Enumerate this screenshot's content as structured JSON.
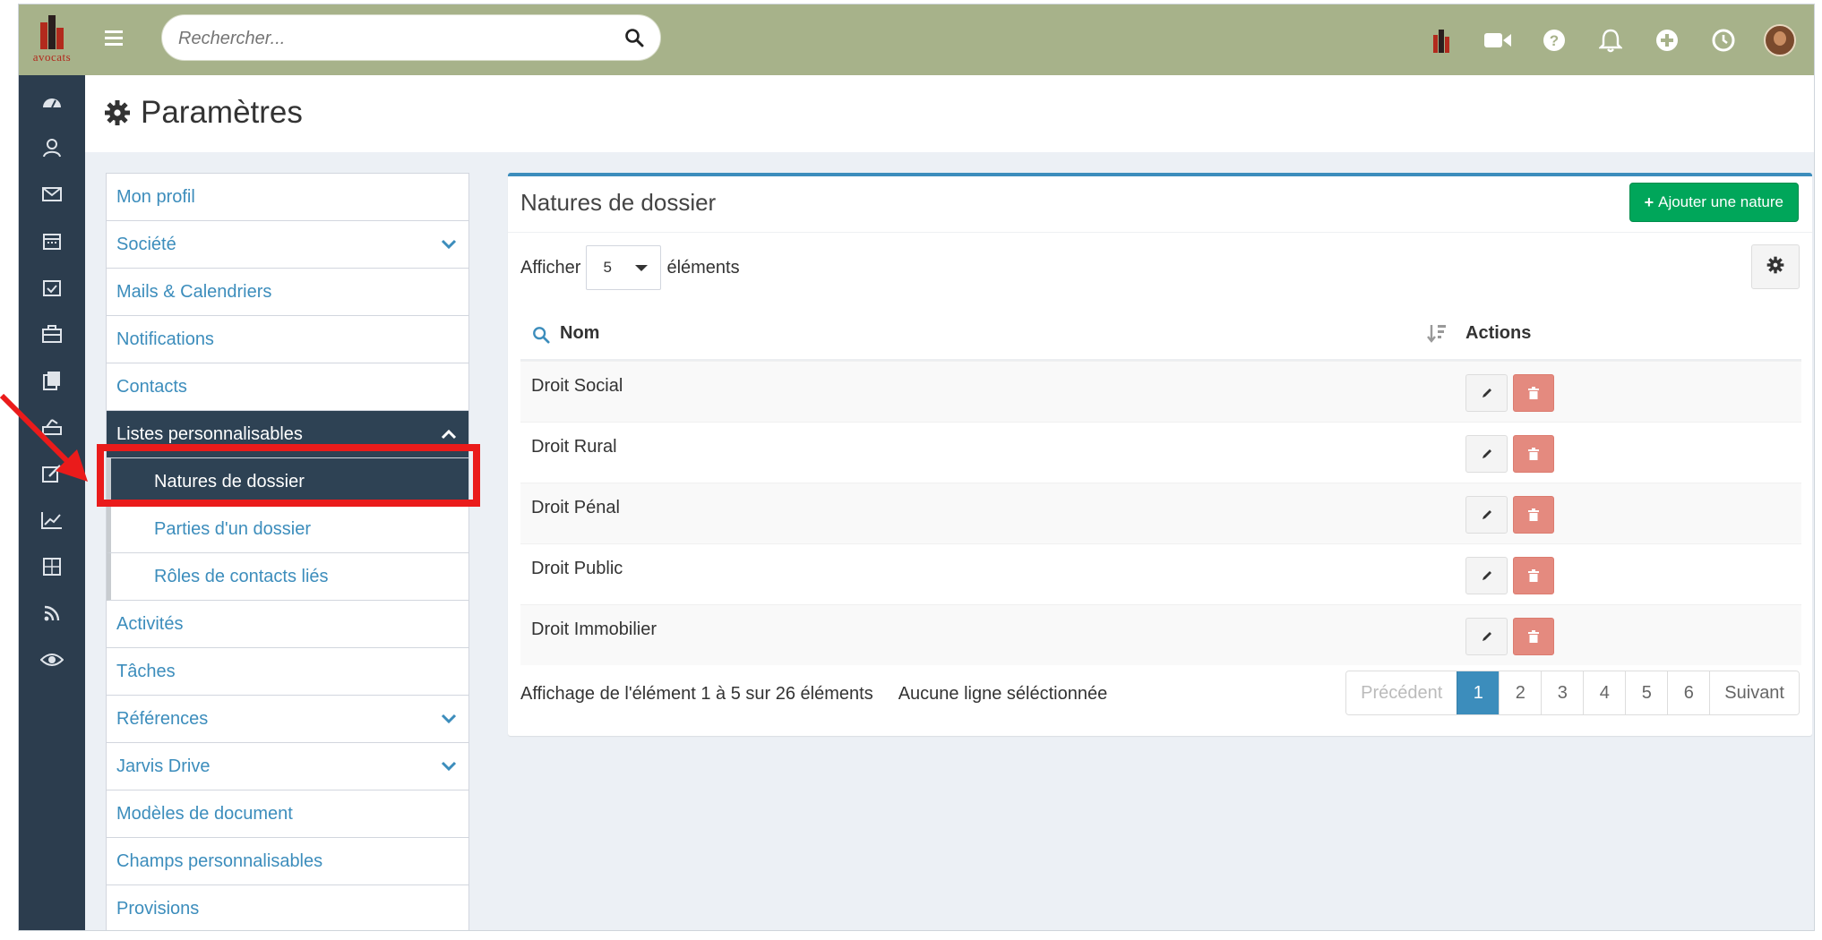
{
  "brand": {
    "word": "avocats",
    "colors": {
      "topbar": "#a7b28a",
      "sidebar": "#2c3d4e",
      "accent": "#3c8dbc",
      "success": "#00a65a",
      "danger": "#e48a7f",
      "highlight": "#ea1b1b"
    }
  },
  "search": {
    "placeholder": "Rechercher..."
  },
  "top_icons": [
    "brand-icon",
    "video-icon",
    "help-icon",
    "bell-icon",
    "plus-circle-icon",
    "clock-icon",
    "avatar"
  ],
  "left_nav": [
    "dashboard-icon",
    "contacts-icon",
    "mail-icon",
    "calendar-icon",
    "tasks-icon",
    "briefcase-icon",
    "documents-icon",
    "billing-icon",
    "edit-icon",
    "stats-icon",
    "calculator-icon",
    "rss-icon",
    "eye-icon"
  ],
  "page": {
    "title": "Paramètres"
  },
  "settings_menu": {
    "items": [
      {
        "label": "Mon profil"
      },
      {
        "label": "Société"
      },
      {
        "label": "Mails & Calendriers"
      },
      {
        "label": "Notifications"
      },
      {
        "label": "Contacts"
      },
      {
        "label": "Listes personnalisables"
      },
      {
        "label": "Natures de dossier"
      },
      {
        "label": "Parties d'un dossier"
      },
      {
        "label": "Rôles de contacts liés"
      },
      {
        "label": "Activités"
      },
      {
        "label": "Tâches"
      },
      {
        "label": "Références"
      },
      {
        "label": "Jarvis Drive"
      },
      {
        "label": "Modèles de document"
      },
      {
        "label": "Champs personnalisables"
      },
      {
        "label": "Provisions"
      }
    ]
  },
  "panel": {
    "title": "Natures de dossier",
    "add_button": "Ajouter une nature",
    "show_label": "Afficher",
    "page_size": "5",
    "elements_label": "éléments",
    "columns": {
      "name": "Nom",
      "actions": "Actions"
    },
    "rows": [
      "Droit Social",
      "Droit Rural",
      "Droit Pénal",
      "Droit Public",
      "Droit Immobilier"
    ],
    "info": "Affichage de l'élément 1 à 5 sur 26 éléments",
    "selection": "Aucune ligne séléctionnée",
    "pagination": {
      "prev": "Précédent",
      "pages": [
        "1",
        "2",
        "3",
        "4",
        "5",
        "6"
      ],
      "current": "1",
      "next": "Suivant"
    }
  }
}
